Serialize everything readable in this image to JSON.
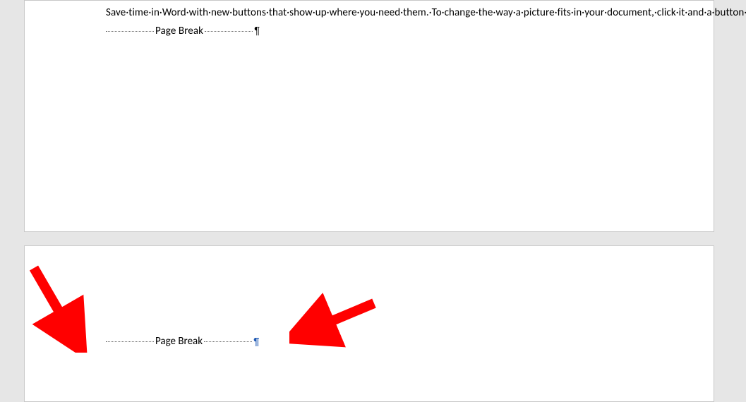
{
  "page1": {
    "paragraph_display": "Save·time·in·Word·with·new·buttons·that·show·up·where·you·need·them.·To·change·the·way·a·picture·fits·in·your·document,·click·it·and·a·button·for·layout·options·appears·next·to·it.·When·you·work·on·a·table,·click·where·you·want·to·add·a·row·or·a·column,·and·then·click·the·plus·sign.¶",
    "page_break_label": "Page Break",
    "page_break_pilcrow": "¶"
  },
  "page2": {
    "page_break_label": "Page Break",
    "page_break_pilcrow": "¶"
  },
  "annotations": {
    "arrow1": {
      "role": "annotation-arrow",
      "color": "#ff0000"
    },
    "arrow2": {
      "role": "annotation-arrow",
      "color": "#ff0000"
    }
  }
}
